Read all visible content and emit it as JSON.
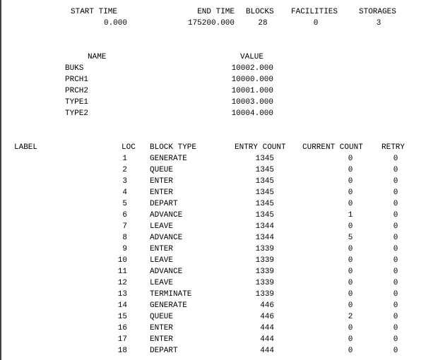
{
  "summary": {
    "headers": {
      "start_time": "START TIME",
      "end_time": "END TIME",
      "blocks": "BLOCKS",
      "facilities": "FACILITIES",
      "storages": "STORAGES"
    },
    "values": {
      "start_time": "0.000",
      "end_time": "175200.000",
      "blocks": "28",
      "facilities": "0",
      "storages": "3"
    }
  },
  "names": {
    "headers": {
      "name": "NAME",
      "value": "VALUE"
    },
    "rows": [
      {
        "name": "BUKS",
        "value": "10002.000"
      },
      {
        "name": "PRCH1",
        "value": "10000.000"
      },
      {
        "name": "PRCH2",
        "value": "10001.000"
      },
      {
        "name": "TYPE1",
        "value": "10003.000"
      },
      {
        "name": "TYPE2",
        "value": "10004.000"
      }
    ]
  },
  "blocks_table": {
    "headers": {
      "label": "LABEL",
      "loc": "LOC",
      "block_type": "BLOCK TYPE",
      "entry_count": "ENTRY COUNT",
      "current_count": "CURRENT COUNT",
      "retry": "RETRY"
    },
    "rows": [
      {
        "loc": "1",
        "type": "GENERATE",
        "entry": "1345",
        "current": "0",
        "retry": "0"
      },
      {
        "loc": "2",
        "type": "QUEUE",
        "entry": "1345",
        "current": "0",
        "retry": "0"
      },
      {
        "loc": "3",
        "type": "ENTER",
        "entry": "1345",
        "current": "0",
        "retry": "0"
      },
      {
        "loc": "4",
        "type": "ENTER",
        "entry": "1345",
        "current": "0",
        "retry": "0"
      },
      {
        "loc": "5",
        "type": "DEPART",
        "entry": "1345",
        "current": "0",
        "retry": "0"
      },
      {
        "loc": "6",
        "type": "ADVANCE",
        "entry": "1345",
        "current": "1",
        "retry": "0"
      },
      {
        "loc": "7",
        "type": "LEAVE",
        "entry": "1344",
        "current": "0",
        "retry": "0"
      },
      {
        "loc": "8",
        "type": "ADVANCE",
        "entry": "1344",
        "current": "5",
        "retry": "0"
      },
      {
        "loc": "9",
        "type": "ENTER",
        "entry": "1339",
        "current": "0",
        "retry": "0"
      },
      {
        "loc": "10",
        "type": "LEAVE",
        "entry": "1339",
        "current": "0",
        "retry": "0"
      },
      {
        "loc": "11",
        "type": "ADVANCE",
        "entry": "1339",
        "current": "0",
        "retry": "0"
      },
      {
        "loc": "12",
        "type": "LEAVE",
        "entry": "1339",
        "current": "0",
        "retry": "0"
      },
      {
        "loc": "13",
        "type": "TERMINATE",
        "entry": "1339",
        "current": "0",
        "retry": "0"
      },
      {
        "loc": "14",
        "type": "GENERATE",
        "entry": "446",
        "current": "0",
        "retry": "0"
      },
      {
        "loc": "15",
        "type": "QUEUE",
        "entry": "446",
        "current": "2",
        "retry": "0"
      },
      {
        "loc": "16",
        "type": "ENTER",
        "entry": "444",
        "current": "0",
        "retry": "0"
      },
      {
        "loc": "17",
        "type": "ENTER",
        "entry": "444",
        "current": "0",
        "retry": "0"
      },
      {
        "loc": "18",
        "type": "DEPART",
        "entry": "444",
        "current": "0",
        "retry": "0"
      }
    ]
  }
}
